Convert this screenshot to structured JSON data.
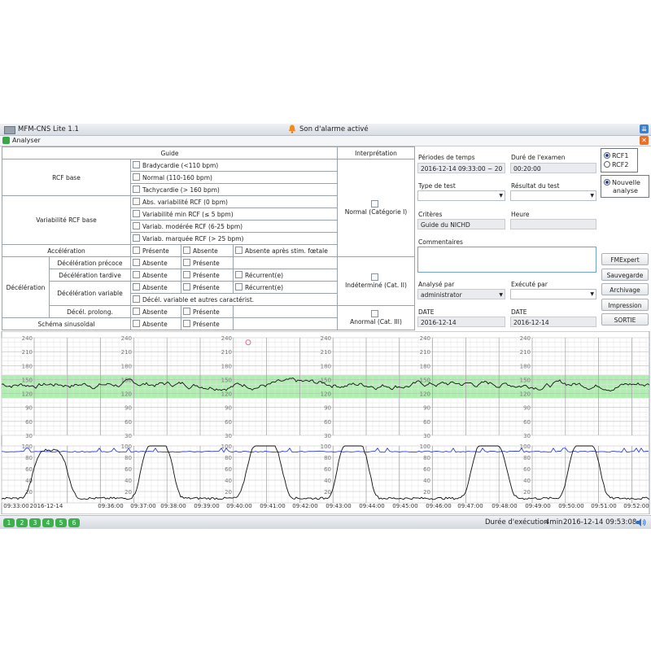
{
  "window": {
    "title": "MFM-CNS Lite 1.1",
    "alarm": "Son d'alarme activé"
  },
  "menu": {
    "analyser": "Analyser"
  },
  "guide": {
    "header_guide": "Guide",
    "header_interp": "Interprétation",
    "rcf_base": "RCF base",
    "bradycardie": "Bradycardie (<110 bpm)",
    "normal_rate": "Normal (110-160 bpm)",
    "tachycardie": "Tachycardie (> 160 bpm)",
    "variabilite": "Variabilité RCF base",
    "var_abs": "Abs. variabilité RCF (0 bpm)",
    "var_min": "Variabilité min RCF (≤ 5 bpm)",
    "var_mod": "Variab. modérée RCF (6-25 bpm)",
    "var_marq": "Variab. marquée RCF (> 25 bpm)",
    "acceleration": "Accélération",
    "presente": "Présente",
    "absente": "Absente",
    "absente_stim": "Absente après stim. fœtale",
    "deceleration": "Décélération",
    "dec_precoce": "Décélération précoce",
    "dec_tardive": "Décélération tardive",
    "dec_variable": "Décélération variable",
    "dec_var_autres": "Décél. variable et autres caractérist.",
    "dec_prolong": "Décél. prolong.",
    "recurrent": "Récurrent(e)",
    "sinusoidal": "Schéma sinusoïdal",
    "interp_normal": "Normal (Catégorie I)",
    "interp_indet": "Indéterminé (Cat. II)",
    "interp_anormal": "Anormal (Cat. III)"
  },
  "form": {
    "periodes_label": "Périodes de temps",
    "periodes_value": "2016-12-14 09:33:00 ~ 20",
    "duree_label": "Duré de l'examen",
    "duree_value": "00:20:00",
    "type_test_label": "Type de test",
    "resultat_label": "Résultat du test",
    "criteres_label": "Critères",
    "criteres_value": "Guide du NICHD",
    "heure_label": "Heure",
    "commentaires_label": "Commentaires",
    "analyse_par_label": "Analysé par",
    "analyse_par_value": "administrator",
    "execute_par_label": "Exécuté par",
    "date_label_1": "DATE",
    "date_value_1": "2016-12-14",
    "date_label_2": "DATE",
    "date_value_2": "2016-12-14"
  },
  "side": {
    "rcf1": "RCF1",
    "rcf2": "RCF2",
    "nouvelle1": "Nouvelle",
    "nouvelle2": "analyse",
    "buttons": [
      "FMExpert",
      "Sauvegarde",
      "Archivage",
      "Impression",
      "SORTIE"
    ]
  },
  "chart": {
    "fhr_ticks": [
      "240",
      "210",
      "180",
      "150",
      "120",
      "90",
      "60",
      "30"
    ],
    "uc_ticks": [
      "100",
      "80",
      "60",
      "40",
      "20"
    ],
    "time_labels": [
      "09:33:00",
      "09:36:00",
      "09:37:00",
      "09:38:00",
      "09:39:00",
      "09:40:00",
      "09:41:00",
      "09:42:00",
      "09:43:00",
      "09:44:00",
      "09:45:00",
      "09:46:00",
      "09:47:00",
      "09:48:00",
      "09:49:00",
      "09:50:00",
      "09:51:00",
      "09:52:00"
    ],
    "start_date": "2016-12-14",
    "normal_band": [
      110,
      160
    ],
    "colors": {
      "fhr": "#111111",
      "uc": "#111111",
      "mhr": "#3344dd",
      "band": "#8ee68e",
      "grid": "#c9c9c9"
    }
  },
  "status": {
    "pages": [
      "1",
      "2",
      "3",
      "4",
      "5",
      "6"
    ],
    "duree": "Durée d'exécution",
    "duree_value": "4min",
    "timestamp": "2016-12-14 09:53:08"
  }
}
